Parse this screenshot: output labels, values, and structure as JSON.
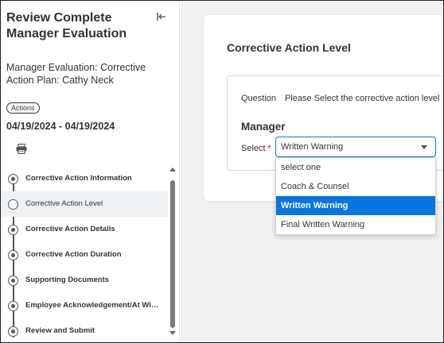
{
  "sidebar": {
    "title": "Review Complete Manager Evaluation",
    "subtitle": "Manager Evaluation: Corrective Action Plan: Cathy Neck",
    "actions_label": "Actions",
    "date_range": "04/19/2024 - 04/19/2024",
    "steps": [
      {
        "label": "Corrective Action Information",
        "state": "done"
      },
      {
        "label": "Corrective Action Level",
        "state": "current"
      },
      {
        "label": "Corrective Action Details",
        "state": "done"
      },
      {
        "label": "Corrective Action Duration",
        "state": "done"
      },
      {
        "label": "Supporting Documents",
        "state": "done"
      },
      {
        "label": "Employee Acknowledgement/At Will D...",
        "state": "done"
      },
      {
        "label": "Review and Submit",
        "state": "done"
      }
    ]
  },
  "main": {
    "card_title": "Corrective Action Level",
    "question_label": "Question",
    "question_text": "Please Select the corrective action level",
    "section_label": "Manager",
    "select_label": "Select",
    "required_mark": "*",
    "selected_value": "Written Warning",
    "options": [
      "select one",
      "Coach & Counsel",
      "Written Warning",
      "Final Written Warning"
    ],
    "highlighted_option_index": 2
  },
  "colors": {
    "accent": "#0875e1",
    "required": "#c0392b",
    "background": "#f0f1f2"
  }
}
